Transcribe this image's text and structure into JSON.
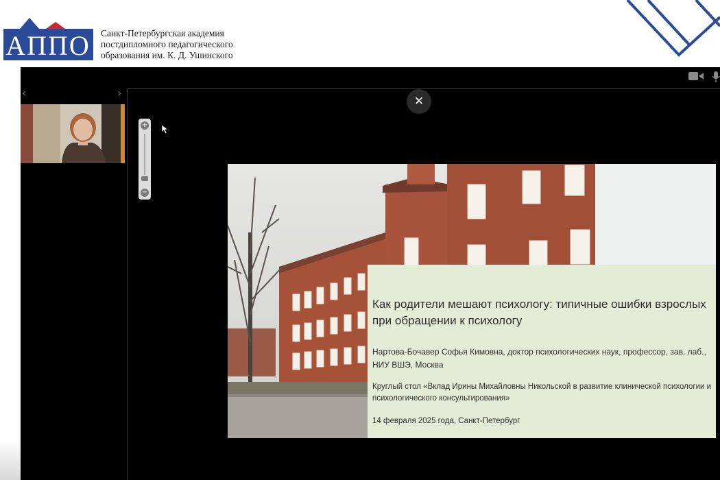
{
  "header": {
    "logo_text": "АППО",
    "org_lines": [
      "Санкт-Петербургская академия",
      "постдипломного педагогического",
      "образования им. К. Д. Ушинского"
    ],
    "brand_color": "#2b4a9a"
  },
  "conference": {
    "prev_arrow": "‹",
    "next_arrow": "›",
    "camera_icon": "camera-icon",
    "mic_icon": "microphone-icon"
  },
  "viewer": {
    "close_label": "✕",
    "zoom_in_label": "+",
    "zoom_out_label": "−"
  },
  "slide": {
    "title": "Как родители мешают психологу: типичные ошибки взрослых при обращении к психологу",
    "author": "Нартова-Бочавер Софья Кимовна, доктор психологических наук, профессор, зав. лаб., НИУ ВШЭ, Москва",
    "event": "Круглый стол «Вклад Ирины Михайловны Никольской в развитие клинической психологии и психологического консультирования»",
    "date": "14 февраля 2025 года, Санкт-Петербург",
    "panel_color": "#e3ecd6"
  }
}
